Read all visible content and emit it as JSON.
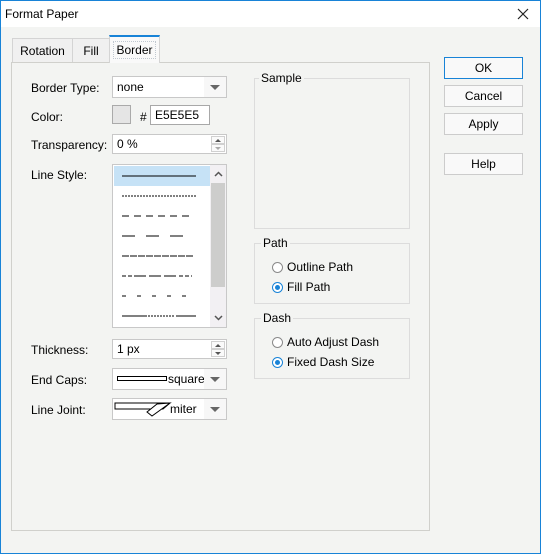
{
  "window": {
    "title": "Format Paper",
    "close_icon": "close-icon"
  },
  "tabs": [
    {
      "label": "Rotation",
      "active": false
    },
    {
      "label": "Fill",
      "active": false
    },
    {
      "label": "Border",
      "active": true
    }
  ],
  "form": {
    "border_type": {
      "label": "Border Type:",
      "value": "none"
    },
    "color": {
      "label": "Color:",
      "hash": "#",
      "value": "E5E5E5",
      "swatch_hex": "#E5E5E5"
    },
    "transparency": {
      "label": "Transparency:",
      "value": "0 %"
    },
    "line_style": {
      "label": "Line Style:",
      "options": [
        "solid",
        "dash-short",
        "dash-medium",
        "dash-long",
        "dash-dense",
        "dash-dot-mixed",
        "dot-sparse",
        "long-short-long"
      ],
      "selected_index": 0
    },
    "thickness": {
      "label": "Thickness:",
      "value": "1 px"
    },
    "end_caps": {
      "label": "End Caps:",
      "value": "square"
    },
    "line_joint": {
      "label": "Line Joint:",
      "value": "miter"
    }
  },
  "sample": {
    "legend": "Sample"
  },
  "path": {
    "legend": "Path",
    "options": [
      {
        "label": "Outline Path",
        "checked": false
      },
      {
        "label": "Fill Path",
        "checked": true
      }
    ]
  },
  "dash": {
    "legend": "Dash",
    "options": [
      {
        "label": "Auto Adjust Dash",
        "checked": false
      },
      {
        "label": "Fixed Dash Size",
        "checked": true
      }
    ]
  },
  "buttons": {
    "ok": "OK",
    "cancel": "Cancel",
    "apply": "Apply",
    "help": "Help"
  },
  "colors": {
    "accent": "#1883D7",
    "selection": "#C6E2F6",
    "background": "#F3F4F2"
  }
}
